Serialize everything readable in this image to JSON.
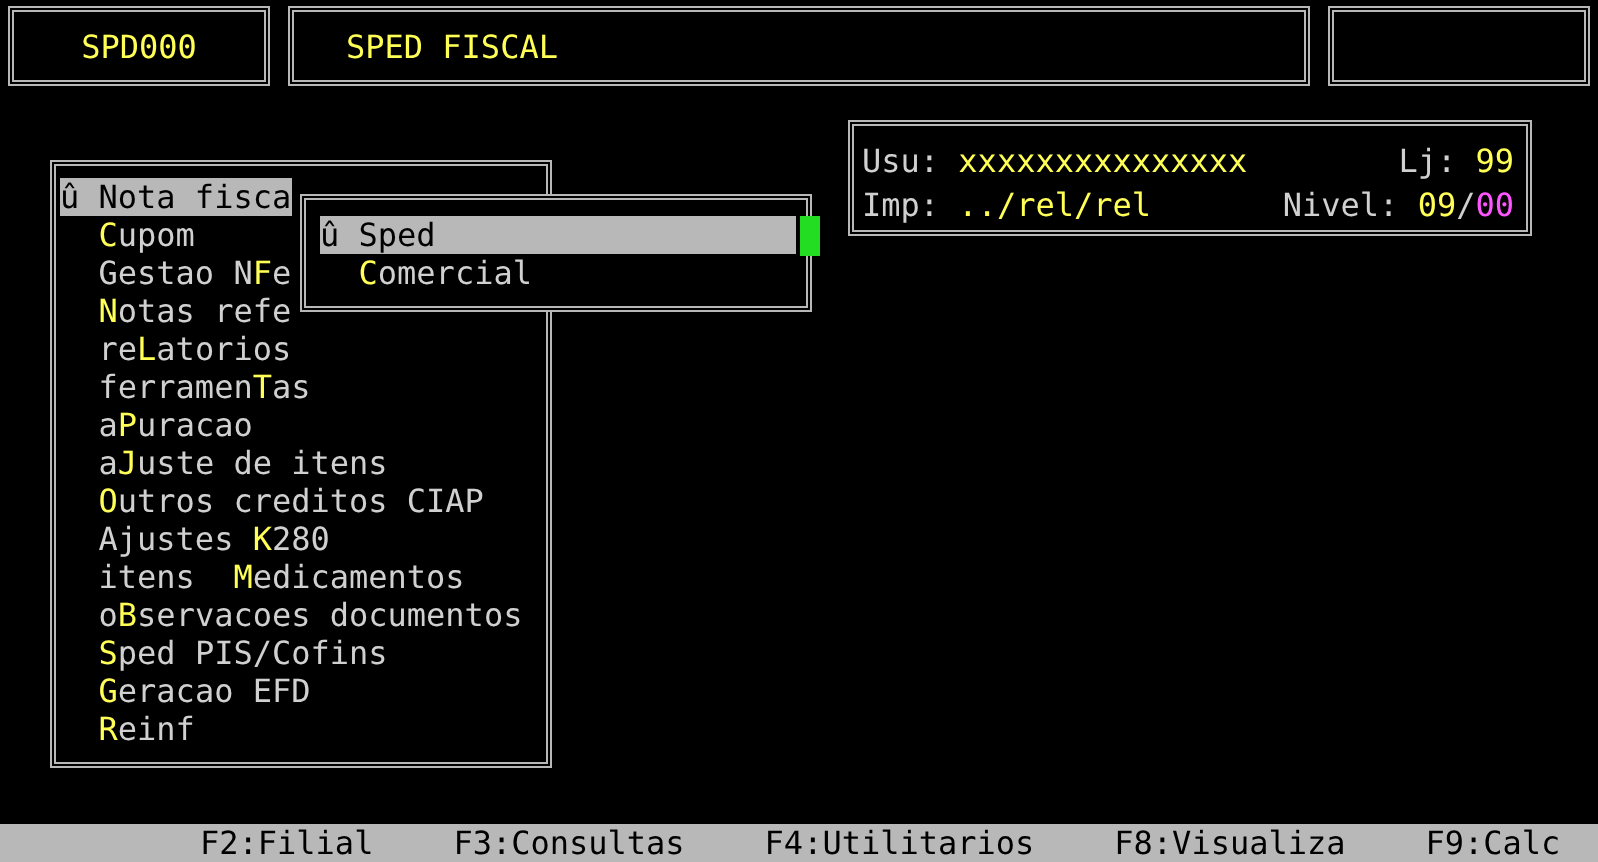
{
  "header": {
    "code": "SPD000",
    "title": "SPED FISCAL"
  },
  "info": {
    "user_label": "Usu:",
    "user": "xxxxxxxxxxxxxxx",
    "store_label": "Lj:",
    "store": "99",
    "printer_label": "Imp:",
    "printer": "../rel/rel",
    "level_label": "Nivel:",
    "level_current": "09",
    "level_separator": "/",
    "level_max": "00"
  },
  "main_menu": {
    "marker": "û",
    "items": [
      {
        "rest": "Nota fisca",
        "selected": true
      },
      {
        "hotkey": "C",
        "rest": "upom",
        "selected": false
      },
      {
        "prefix": "Gestao N",
        "hotkey": "F",
        "rest": "e",
        "selected": false
      },
      {
        "hotkey": "N",
        "rest": "otas refe",
        "selected": false
      },
      {
        "prefix": "re",
        "hotkey": "L",
        "rest": "atorios",
        "selected": false
      },
      {
        "prefix": "ferramen",
        "hotkey": "T",
        "rest": "as",
        "selected": false
      },
      {
        "prefix": "a",
        "hotkey": "P",
        "rest": "uracao",
        "selected": false
      },
      {
        "prefix": "a",
        "hotkey": "J",
        "rest": "uste de itens",
        "selected": false
      },
      {
        "hotkey": "O",
        "rest": "utros creditos CIAP",
        "selected": false
      },
      {
        "prefix": "Ajustes ",
        "hotkey": "K",
        "rest": "280",
        "selected": false
      },
      {
        "prefix": "itens  ",
        "hotkey": "M",
        "rest": "edicamentos",
        "selected": false
      },
      {
        "prefix": "o",
        "hotkey": "B",
        "rest": "servacoes documentos",
        "selected": false
      },
      {
        "hotkey": "S",
        "rest": "ped PIS/Cofins",
        "selected": false
      },
      {
        "hotkey": "G",
        "rest": "eracao EFD",
        "selected": false
      },
      {
        "hotkey": "R",
        "rest": "einf",
        "selected": false
      }
    ]
  },
  "submenu": {
    "marker": "û",
    "items": [
      {
        "rest": "Sped",
        "selected": true
      },
      {
        "hotkey": "C",
        "rest": "omercial",
        "selected": false
      }
    ]
  },
  "function_keys": [
    "F2:Filial",
    "F3:Consultas",
    "F4:Utilitarios",
    "F8:Visualiza",
    "F9:Calc"
  ]
}
